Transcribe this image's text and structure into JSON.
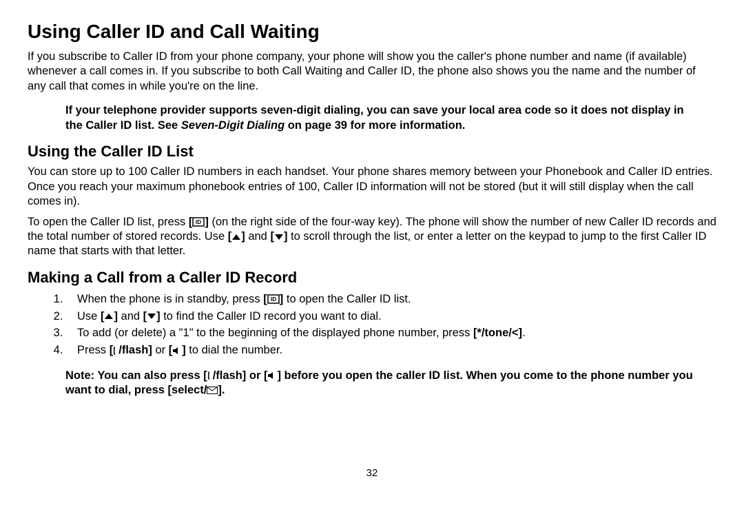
{
  "heading1": "Using Caller ID and Call Waiting",
  "p1": "If you subscribe to Caller ID from your phone company, your phone will show you the caller's phone number and name (if available) whenever a call comes in. If you subscribe to both Call Waiting and Caller ID, the phone also shows you the name and the number of any call that comes in while you're on the line.",
  "note1_a": "If your telephone provider supports seven-digit dialing, you can save your local area code so it does not display in the Caller ID list. See ",
  "note1_italic": "Seven-Digit Dialing",
  "note1_b": " on page 39 for more information.",
  "heading2": "Using the Caller ID List",
  "p2": "You can store up to 100 Caller ID numbers in each handset. Your phone shares memory between your Phonebook and Caller ID entries. Once you reach your maximum phonebook entries of 100, Caller ID information will not be stored (but it will still display when the call comes in).",
  "p3_a": "To open the Caller ID list, press ",
  "p3_b": " (on the right side of the four-way key). The phone will show the number of new Caller ID records and the total number of stored records. Use ",
  "p3_c": " and ",
  "p3_d": " to scroll through the list, or enter a letter on the keypad to jump to the first Caller ID name that starts with that letter.",
  "heading3": "Making a Call from a Caller ID Record",
  "li1_a": "When the phone is in standby, press ",
  "li1_b": " to open the Caller ID list.",
  "li2_a": "Use ",
  "li2_b": " and ",
  "li2_c": " to find the Caller ID record you want to dial.",
  "li3_a": "To add (or delete) a \"1\" to the beginning of the displayed phone number, press ",
  "li3_key": "[*/tone/<]",
  "li3_b": ".",
  "li4_a": "Press ",
  "li4_flash": "/flash]",
  "li4_b": " or ",
  "li4_c": " to dial the number.",
  "note2_a": "Note: You can also press [",
  "note2_flash": "/flash] or [",
  "note2_b": "] before you open the caller ID list. When you come to the phone number you want to dial, press  [select/",
  "note2_c": "].",
  "page_number": "32"
}
